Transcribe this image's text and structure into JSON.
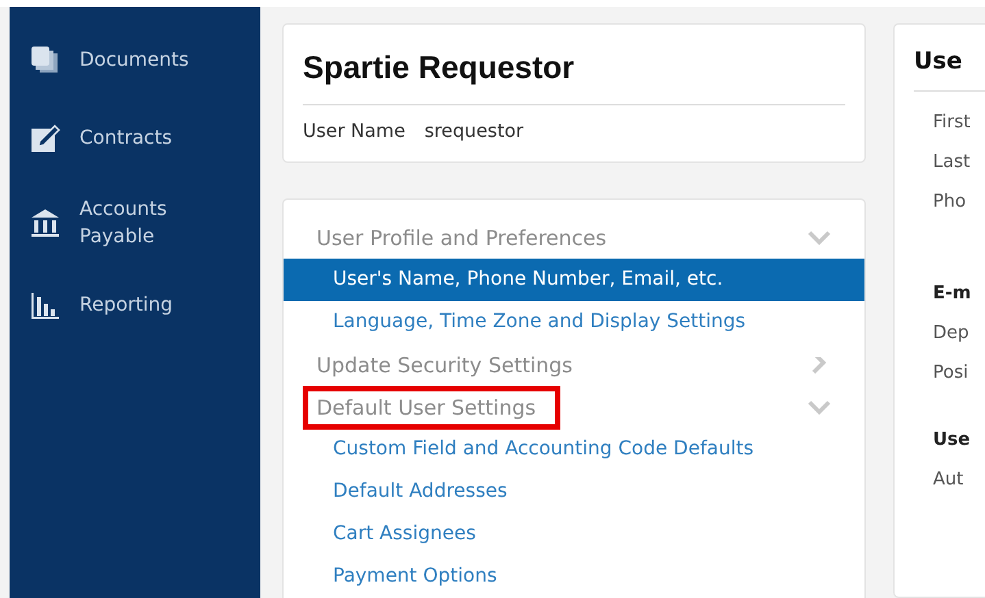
{
  "sidebar": {
    "items": [
      {
        "label": "Documents"
      },
      {
        "label": "Contracts"
      },
      {
        "label": "Accounts Payable"
      },
      {
        "label": "Reporting"
      }
    ]
  },
  "profile_card": {
    "title": "Spartie Requestor",
    "field_label": "User Name",
    "field_value": "srequestor"
  },
  "settings_menu": {
    "sections": [
      {
        "title": "User Profile and Preferences",
        "expanded": true,
        "highlighted": false,
        "items": [
          {
            "label": "User's Name, Phone Number, Email, etc.",
            "selected": true
          },
          {
            "label": "Language, Time Zone and Display Settings",
            "selected": false
          }
        ]
      },
      {
        "title": "Update Security Settings",
        "expanded": false,
        "highlighted": false
      },
      {
        "title": "Default User Settings",
        "expanded": true,
        "highlighted": true,
        "items": [
          {
            "label": "Custom Field and Accounting Code Defaults",
            "selected": false
          },
          {
            "label": "Default Addresses",
            "selected": false
          },
          {
            "label": "Cart Assignees",
            "selected": false
          },
          {
            "label": "Payment Options",
            "selected": false
          }
        ]
      }
    ]
  },
  "detail_card": {
    "title": "Use",
    "rows": [
      {
        "text": "First",
        "kind": "label"
      },
      {
        "text": "Last",
        "kind": "label"
      },
      {
        "text": "Pho",
        "kind": "label"
      },
      {
        "text": "E-m",
        "kind": "heading"
      },
      {
        "text": "Dep",
        "kind": "label"
      },
      {
        "text": "Posi",
        "kind": "label"
      },
      {
        "text": "Use",
        "kind": "heading"
      },
      {
        "text": "Aut",
        "kind": "label"
      }
    ]
  }
}
